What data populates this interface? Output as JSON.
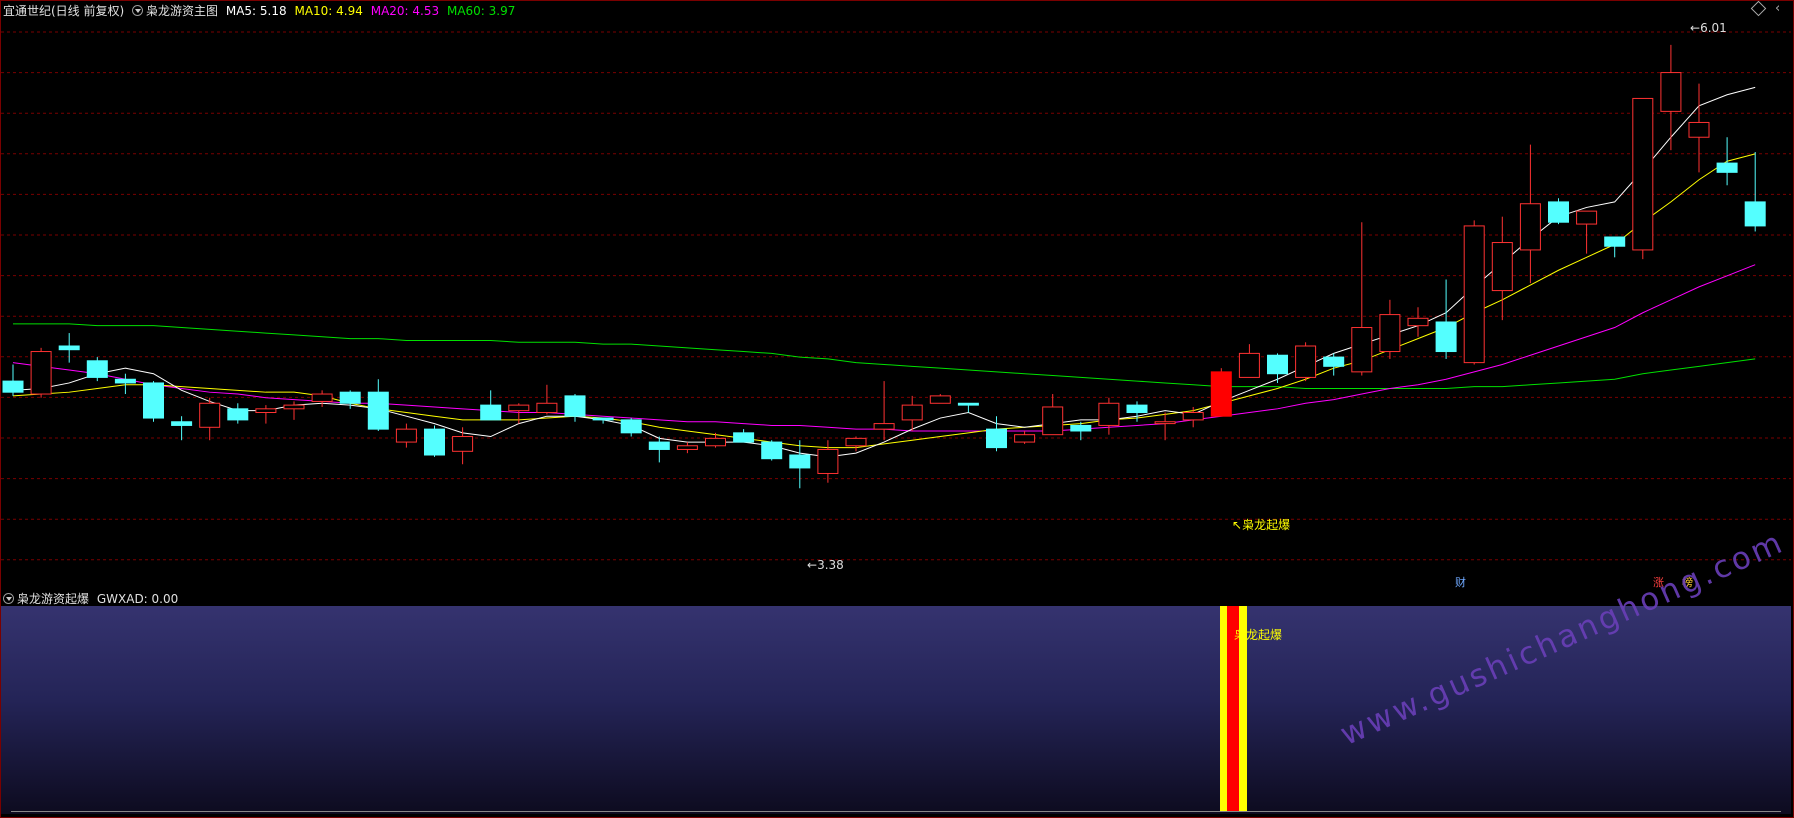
{
  "main_header": {
    "stock_name": "宜通世纪(日线 前复权)",
    "indicator_name": "枭龙游资主图",
    "ma5_label": "MA5: 5.18",
    "ma10_label": "MA10: 4.94",
    "ma20_label": "MA20: 4.53",
    "ma60_label": "MA60: 3.97"
  },
  "sub_header": {
    "indicator_name": "枭龙游资起爆",
    "value_label": "GWXAD: 0.00"
  },
  "annotations": {
    "high_label": "6.01",
    "low_label": "3.38",
    "signal_label": "枭龙起爆",
    "sub_signal_label": "枭龙起爆",
    "badge_cai": "财",
    "badge_zhang": "涨",
    "badge_bang": "榜"
  },
  "watermark": "www.gushichanghong.com",
  "colors": {
    "up": "#ff3232",
    "down": "#54ffff",
    "ma5": "#ffffff",
    "ma10": "#ffff00",
    "ma20": "#ff00ff",
    "ma60": "#00e000",
    "grid": "#7a0000",
    "signal": "#ff0000",
    "signal_edge": "#ffff00"
  },
  "chart_data": {
    "type": "candlestick",
    "ylim": [
      3.2,
      6.15
    ],
    "signal_index": 43,
    "candles": [
      [
        4.19,
        4.13,
        4.28,
        4.11
      ],
      [
        4.12,
        4.35,
        4.37,
        4.1
      ],
      [
        4.38,
        4.36,
        4.45,
        4.29
      ],
      [
        4.3,
        4.21,
        4.32,
        4.19
      ],
      [
        4.2,
        4.18,
        4.23,
        4.12
      ],
      [
        4.18,
        3.99,
        4.19,
        3.97
      ],
      [
        3.97,
        3.95,
        4.0,
        3.87
      ],
      [
        3.94,
        4.07,
        4.1,
        3.87
      ],
      [
        4.04,
        3.98,
        4.07,
        3.96
      ],
      [
        4.02,
        4.04,
        4.06,
        3.96
      ],
      [
        4.04,
        4.06,
        4.08,
        3.98
      ],
      [
        4.08,
        4.12,
        4.14,
        4.05
      ],
      [
        4.13,
        4.07,
        4.14,
        4.04
      ],
      [
        4.13,
        3.93,
        4.2,
        3.92
      ],
      [
        3.86,
        3.93,
        3.96,
        3.83
      ],
      [
        3.93,
        3.79,
        3.95,
        3.78
      ],
      [
        3.81,
        3.89,
        3.94,
        3.74
      ],
      [
        4.06,
        3.98,
        4.14,
        3.98
      ],
      [
        4.03,
        4.06,
        4.07,
        3.96
      ],
      [
        4.02,
        4.07,
        4.17,
        4.01
      ],
      [
        4.11,
        4.0,
        4.12,
        3.97
      ],
      [
        3.99,
        3.98,
        3.99,
        3.96
      ],
      [
        3.98,
        3.91,
        3.99,
        3.89
      ],
      [
        3.86,
        3.82,
        3.89,
        3.75
      ],
      [
        3.82,
        3.84,
        3.86,
        3.8
      ],
      [
        3.84,
        3.88,
        3.91,
        3.83
      ],
      [
        3.91,
        3.86,
        3.93,
        3.86
      ],
      [
        3.86,
        3.77,
        3.87,
        3.76
      ],
      [
        3.79,
        3.72,
        3.87,
        3.61
      ],
      [
        3.69,
        3.82,
        3.87,
        3.64
      ],
      [
        3.84,
        3.88,
        3.89,
        3.81
      ],
      [
        3.93,
        3.96,
        4.19,
        3.87
      ],
      [
        3.98,
        4.06,
        4.11,
        3.92
      ],
      [
        4.07,
        4.11,
        4.12,
        4.07
      ],
      [
        4.07,
        4.06,
        4.07,
        4.02
      ],
      [
        3.93,
        3.83,
        4.0,
        3.81
      ],
      [
        3.86,
        3.9,
        3.92,
        3.85
      ],
      [
        3.9,
        4.05,
        4.12,
        3.92
      ],
      [
        3.95,
        3.92,
        3.97,
        3.87
      ],
      [
        3.95,
        4.07,
        4.1,
        3.9
      ],
      [
        4.06,
        4.02,
        4.08,
        3.97
      ],
      [
        3.96,
        3.97,
        4.02,
        3.87
      ],
      [
        3.98,
        4.02,
        4.05,
        3.94
      ],
      [
        4.0,
        4.24,
        4.26,
        4.0
      ],
      [
        4.21,
        4.34,
        4.39,
        4.21
      ],
      [
        4.33,
        4.23,
        4.34,
        4.18
      ],
      [
        4.21,
        4.38,
        4.4,
        4.19
      ],
      [
        4.32,
        4.27,
        4.34,
        4.22
      ],
      [
        4.24,
        4.48,
        5.05,
        4.22
      ],
      [
        4.35,
        4.55,
        4.63,
        4.31
      ],
      [
        4.49,
        4.53,
        4.59,
        4.43
      ],
      [
        4.51,
        4.35,
        4.74,
        4.31
      ],
      [
        4.29,
        5.03,
        5.06,
        4.28
      ],
      [
        4.68,
        4.94,
        5.08,
        4.52
      ],
      [
        4.9,
        5.15,
        5.47,
        4.72
      ],
      [
        5.16,
        5.05,
        5.18,
        5.04
      ],
      [
        5.04,
        5.11,
        5.09,
        4.88
      ],
      [
        4.97,
        4.92,
        4.97,
        4.86
      ],
      [
        4.9,
        5.72,
        5.72,
        4.85
      ],
      [
        5.65,
        5.86,
        6.01,
        5.44
      ],
      [
        5.51,
        5.59,
        5.8,
        5.32
      ],
      [
        5.37,
        5.32,
        5.51,
        5.25
      ],
      [
        5.16,
        5.03,
        5.43,
        5.0
      ]
    ],
    "ma5": [
      4.14,
      4.15,
      4.18,
      4.23,
      4.26,
      4.23,
      4.14,
      4.08,
      4.03,
      4.03,
      4.06,
      4.07,
      4.06,
      4.04,
      4.0,
      3.96,
      3.91,
      3.89,
      3.96,
      4.0,
      4.0,
      3.98,
      3.95,
      3.88,
      3.86,
      3.86,
      3.86,
      3.84,
      3.8,
      3.78,
      3.8,
      3.86,
      3.93,
      3.99,
      4.02,
      3.96,
      3.94,
      3.96,
      3.98,
      3.98,
      4.0,
      4.03,
      4.01,
      4.08,
      4.14,
      4.2,
      4.27,
      4.34,
      4.39,
      4.44,
      4.49,
      4.56,
      4.7,
      4.83,
      4.96,
      5.08,
      5.13,
      5.16,
      5.33,
      5.51,
      5.68,
      5.74,
      5.78
    ],
    "ma10": [
      4.11,
      4.12,
      4.13,
      4.15,
      4.17,
      4.17,
      4.16,
      4.15,
      4.14,
      4.13,
      4.13,
      4.11,
      4.07,
      4.04,
      4.02,
      4.0,
      3.98,
      3.98,
      3.98,
      3.99,
      4.0,
      3.99,
      3.97,
      3.94,
      3.92,
      3.9,
      3.88,
      3.86,
      3.84,
      3.83,
      3.83,
      3.85,
      3.87,
      3.89,
      3.91,
      3.93,
      3.94,
      3.95,
      3.96,
      3.98,
      3.99,
      4.01,
      4.03,
      4.07,
      4.11,
      4.15,
      4.2,
      4.26,
      4.3,
      4.36,
      4.42,
      4.48,
      4.56,
      4.63,
      4.71,
      4.79,
      4.86,
      4.93,
      5.05,
      5.16,
      5.28,
      5.38,
      5.42
    ],
    "ma20": [
      4.29,
      4.27,
      4.25,
      4.23,
      4.2,
      4.17,
      4.15,
      4.13,
      4.12,
      4.1,
      4.09,
      4.08,
      4.07,
      4.07,
      4.06,
      4.05,
      4.04,
      4.03,
      4.02,
      4.02,
      4.01,
      4.0,
      3.99,
      3.98,
      3.97,
      3.97,
      3.96,
      3.95,
      3.95,
      3.94,
      3.93,
      3.93,
      3.92,
      3.92,
      3.92,
      3.92,
      3.92,
      3.92,
      3.93,
      3.94,
      3.95,
      3.96,
      3.98,
      4.0,
      4.02,
      4.04,
      4.07,
      4.09,
      4.12,
      4.15,
      4.17,
      4.2,
      4.24,
      4.28,
      4.33,
      4.38,
      4.43,
      4.48,
      4.56,
      4.63,
      4.7,
      4.76,
      4.82
    ],
    "ma60": [
      4.5,
      4.5,
      4.5,
      4.49,
      4.49,
      4.49,
      4.48,
      4.47,
      4.46,
      4.45,
      4.44,
      4.43,
      4.42,
      4.42,
      4.41,
      4.41,
      4.41,
      4.41,
      4.4,
      4.4,
      4.4,
      4.39,
      4.39,
      4.38,
      4.37,
      4.36,
      4.35,
      4.34,
      4.32,
      4.31,
      4.29,
      4.28,
      4.27,
      4.26,
      4.25,
      4.24,
      4.23,
      4.22,
      4.21,
      4.2,
      4.19,
      4.18,
      4.17,
      4.16,
      4.16,
      4.16,
      4.15,
      4.15,
      4.15,
      4.15,
      4.15,
      4.15,
      4.16,
      4.16,
      4.17,
      4.18,
      4.19,
      4.2,
      4.23,
      4.25,
      4.27,
      4.29,
      4.31
    ]
  }
}
